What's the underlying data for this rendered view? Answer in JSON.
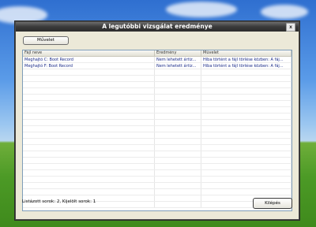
{
  "window": {
    "title": "A legutóbbi vizsgálat eredménye",
    "close_glyph": "x"
  },
  "toolbar": {
    "action_label": "Művelet"
  },
  "table": {
    "headers": [
      "Fájl neve",
      "Eredmény",
      "Művelet"
    ],
    "rows": [
      [
        "Meghajtó C: Boot Record",
        "Nem lehetett ártiz...",
        "Hiba történt a fájl törlése közben: A fáj..."
      ],
      [
        "Meghajtó F: Boot Record",
        "Nem lehetett ártiz...",
        "Hiba történt a fájl törlése közben: A fáj..."
      ]
    ]
  },
  "status": {
    "text": "Listázott sorok: 2, Kijelölt sorok: 1"
  },
  "footer": {
    "close_label": "Kilépés"
  }
}
